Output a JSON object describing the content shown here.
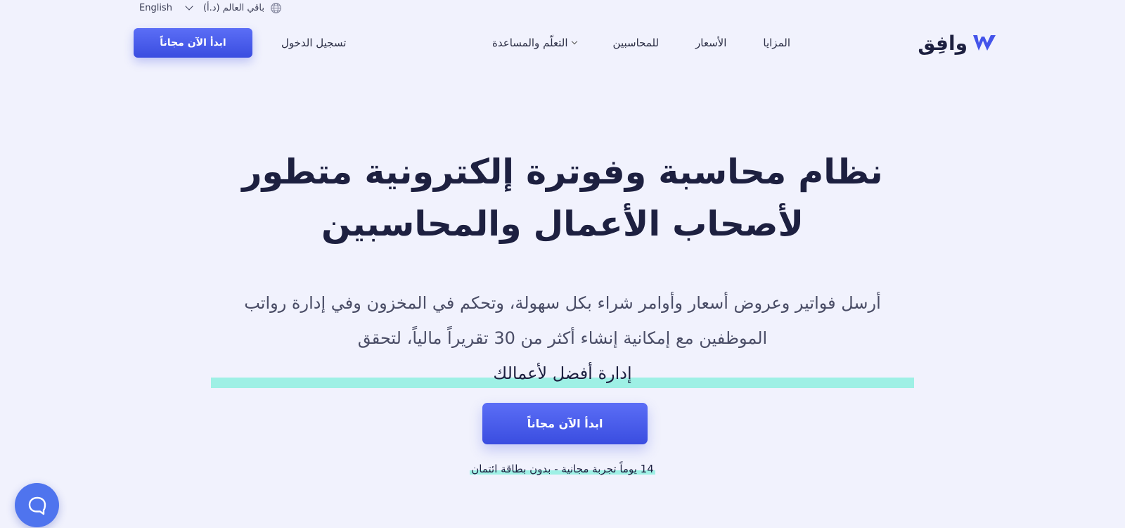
{
  "topbar": {
    "language": "English",
    "region": "باقي العالم (د.أ)"
  },
  "nav": {
    "cta": "ابدأ الآن مجاناً",
    "login": "تسجيل الدخول",
    "links": [
      "المزايا",
      "الأسعار",
      "للمحاسبين",
      "التعلّم والمساعدة"
    ],
    "logo_text": "وافِق"
  },
  "hero": {
    "title_line1": "نظام محاسبة وفوترة إلكترونية متطور",
    "title_line2": "لأصحاب الأعمال والمحاسبين",
    "subtitle_line1": "أرسل فواتير وعروض أسعار وأوامر شراء بكل سهولة، وتحكم في المخزون وفي إدارة رواتب",
    "subtitle_line2_start": "الموظفين مع إمكانية إنشاء أكثر من 30 تقريراً مالياً، لتحقق ",
    "subtitle_highlight": "إدارة أفضل لأعمالك",
    "subtitle_end": ".",
    "cta": "ابدأ الآن مجاناً",
    "trial_note": "14 يوماً تجربة مجانية - بدون بطاقة ائتمان"
  },
  "colors": {
    "background": "#f1f2fd",
    "primary": "#4454ea",
    "highlight": "#9ef0e5",
    "text": "#1d2040",
    "chat": "#4f74ee"
  },
  "icons": [
    "globe-icon",
    "chevron-down-icon",
    "logo-mark-icon",
    "chat-icon"
  ]
}
